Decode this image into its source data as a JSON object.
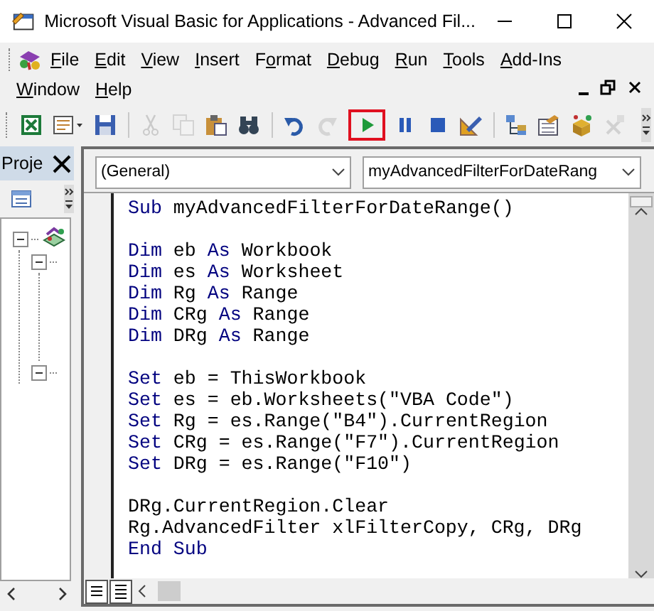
{
  "window": {
    "title": "Microsoft Visual Basic for Applications - Advanced Fil..."
  },
  "menu": {
    "rows": [
      [
        {
          "key": "F",
          "rest": "ile"
        },
        {
          "key": "E",
          "rest": "dit"
        },
        {
          "key": "V",
          "rest": "iew"
        },
        {
          "key": "I",
          "rest": "nsert"
        },
        {
          "lead": "F",
          "key": "o",
          "rest": "rmat"
        },
        {
          "key": "D",
          "rest": "ebug"
        },
        {
          "key": "R",
          "rest": "un"
        },
        {
          "key": "T",
          "rest": "ools"
        },
        {
          "key": "A",
          "rest": "dd-Ins"
        }
      ],
      [
        {
          "key": "W",
          "rest": "indow"
        },
        {
          "key": "H",
          "rest": "elp"
        }
      ]
    ]
  },
  "toolbar": {
    "items": [
      {
        "kind": "excel",
        "disabled": false,
        "highlighted": false
      },
      {
        "kind": "userform",
        "disabled": false,
        "highlighted": false
      },
      {
        "kind": "save",
        "disabled": false,
        "highlighted": false
      },
      {
        "kind": "separator"
      },
      {
        "kind": "cut",
        "disabled": true,
        "highlighted": false
      },
      {
        "kind": "copy",
        "disabled": true,
        "highlighted": false
      },
      {
        "kind": "paste",
        "disabled": false,
        "highlighted": false
      },
      {
        "kind": "find",
        "disabled": false,
        "highlighted": false
      },
      {
        "kind": "separator"
      },
      {
        "kind": "undo",
        "disabled": false,
        "highlighted": false
      },
      {
        "kind": "redo",
        "disabled": true,
        "highlighted": false
      },
      {
        "kind": "run",
        "disabled": false,
        "highlighted": true
      },
      {
        "kind": "pause",
        "disabled": false,
        "highlighted": false
      },
      {
        "kind": "stop",
        "disabled": false,
        "highlighted": false
      },
      {
        "kind": "design",
        "disabled": false,
        "highlighted": false
      },
      {
        "kind": "separator"
      },
      {
        "kind": "project",
        "disabled": false,
        "highlighted": false
      },
      {
        "kind": "properties",
        "disabled": false,
        "highlighted": false
      },
      {
        "kind": "browser",
        "disabled": false,
        "highlighted": false
      },
      {
        "kind": "toolbox",
        "disabled": true,
        "highlighted": false
      }
    ]
  },
  "project_pane": {
    "title": "Proje",
    "tree": [
      {
        "expanded": true,
        "children": [
          {
            "expanded": true
          },
          {
            "expanded": true
          }
        ]
      }
    ]
  },
  "code_pane": {
    "object_dropdown": "(General)",
    "procedure_dropdown": "myAdvancedFilterForDateRang",
    "blocks": [
      [
        [
          {
            "kind": "keyword",
            "text": "Sub"
          },
          {
            "kind": "plain",
            "text": " myAdvancedFilterForDateRange()"
          }
        ]
      ],
      [
        [
          {
            "kind": "keyword",
            "text": "Dim"
          },
          {
            "kind": "plain",
            "text": " eb "
          },
          {
            "kind": "keyword",
            "text": "As"
          },
          {
            "kind": "plain",
            "text": " Workbook"
          }
        ],
        [
          {
            "kind": "keyword",
            "text": "Dim"
          },
          {
            "kind": "plain",
            "text": " es "
          },
          {
            "kind": "keyword",
            "text": "As"
          },
          {
            "kind": "plain",
            "text": " Worksheet"
          }
        ],
        [
          {
            "kind": "keyword",
            "text": "Dim"
          },
          {
            "kind": "plain",
            "text": " Rg "
          },
          {
            "kind": "keyword",
            "text": "As"
          },
          {
            "kind": "plain",
            "text": " Range"
          }
        ],
        [
          {
            "kind": "keyword",
            "text": "Dim"
          },
          {
            "kind": "plain",
            "text": " CRg "
          },
          {
            "kind": "keyword",
            "text": "As"
          },
          {
            "kind": "plain",
            "text": " Range"
          }
        ],
        [
          {
            "kind": "keyword",
            "text": "Dim"
          },
          {
            "kind": "plain",
            "text": " DRg "
          },
          {
            "kind": "keyword",
            "text": "As"
          },
          {
            "kind": "plain",
            "text": " Range"
          }
        ]
      ],
      [
        [
          {
            "kind": "keyword",
            "text": "Set"
          },
          {
            "kind": "plain",
            "text": " eb = ThisWorkbook"
          }
        ],
        [
          {
            "kind": "keyword",
            "text": "Set"
          },
          {
            "kind": "plain",
            "text": " es = eb.Worksheets(\"VBA Code\")"
          }
        ],
        [
          {
            "kind": "keyword",
            "text": "Set"
          },
          {
            "kind": "plain",
            "text": " Rg = es.Range(\"B4\").CurrentRegion"
          }
        ],
        [
          {
            "kind": "keyword",
            "text": "Set"
          },
          {
            "kind": "plain",
            "text": " CRg = es.Range(\"F7\").CurrentRegion"
          }
        ],
        [
          {
            "kind": "keyword",
            "text": "Set"
          },
          {
            "kind": "plain",
            "text": " DRg = es.Range(\"F10\")"
          }
        ]
      ],
      [
        [
          {
            "kind": "plain",
            "text": "DRg.CurrentRegion.Clear"
          }
        ],
        [
          {
            "kind": "plain",
            "text": "Rg.AdvancedFilter xlFilterCopy, CRg, DRg"
          }
        ],
        [
          {
            "kind": "keyword",
            "text": "End Sub"
          }
        ]
      ]
    ]
  }
}
